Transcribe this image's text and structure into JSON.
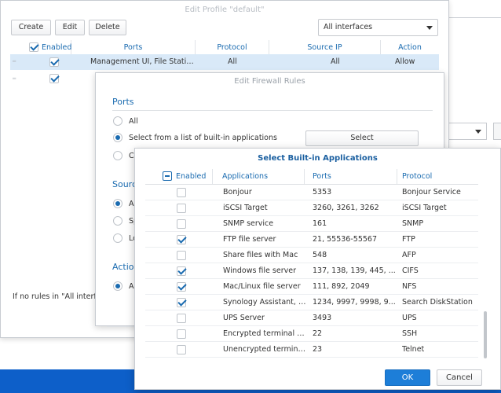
{
  "edit_profile": {
    "title": "Edit Profile \"default\"",
    "create_label": "Create",
    "edit_label": "Edit",
    "delete_label": "Delete",
    "interface_select": "All interfaces",
    "headers": [
      "Enabled",
      "Ports",
      "Protocol",
      "Source IP",
      "Action"
    ],
    "rows": [
      {
        "enabled": true,
        "ports": "Management UI, File Statio...",
        "protocol": "All",
        "source_ip": "All",
        "action": "Allow"
      },
      {
        "enabled": true,
        "ports": "",
        "protocol": "",
        "source_ip": "",
        "action": ""
      }
    ],
    "footer_note": "If no rules in \"All interfac"
  },
  "edit_firewall": {
    "title": "Edit Firewall Rules",
    "ports_section": "Ports",
    "port_options": [
      "All",
      "Select from a list of built-in applications",
      "C"
    ],
    "port_selected": 1,
    "select_button": "Select",
    "source_section": "Sourc",
    "source_options": [
      "Al",
      "Sp",
      "Lo"
    ],
    "source_selected": 0,
    "action_section": "Actio",
    "action_options": [
      "Al"
    ],
    "action_selected": 0
  },
  "builtin_apps": {
    "title": "Select Built-in Applications",
    "headers": [
      "Enabled",
      "Applications",
      "Ports",
      "Protocol"
    ],
    "header_check_state": "mixed",
    "rows": [
      {
        "enabled": false,
        "app": "Bonjour",
        "ports": "5353",
        "protocol": "Bonjour Service"
      },
      {
        "enabled": false,
        "app": "iSCSI Target",
        "ports": "3260, 3261, 3262",
        "protocol": "iSCSI Target"
      },
      {
        "enabled": false,
        "app": "SNMP service",
        "ports": "161",
        "protocol": "SNMP"
      },
      {
        "enabled": true,
        "app": "FTP file server",
        "ports": "21, 55536-55567",
        "protocol": "FTP"
      },
      {
        "enabled": false,
        "app": "Share files with Mac",
        "ports": "548",
        "protocol": "AFP"
      },
      {
        "enabled": true,
        "app": "Windows file server",
        "ports": "137, 138, 139, 445, ...",
        "protocol": "CIFS"
      },
      {
        "enabled": true,
        "app": "Mac/Linux file server",
        "ports": "111, 892, 2049",
        "protocol": "NFS"
      },
      {
        "enabled": true,
        "app": "Synology Assistant, N...",
        "ports": "1234, 9997, 9998, 9...",
        "protocol": "Search DiskStation"
      },
      {
        "enabled": false,
        "app": "UPS Server",
        "ports": "3493",
        "protocol": "UPS"
      },
      {
        "enabled": false,
        "app": "Encrypted terminal s...",
        "ports": "22",
        "protocol": "SSH"
      },
      {
        "enabled": false,
        "app": "Unencrypted terminal...",
        "ports": "23",
        "protocol": "Telnet"
      }
    ],
    "ok_label": "OK",
    "cancel_label": "Cancel"
  },
  "colors": {
    "accent": "#1a6bb0",
    "primary_button": "#1d7ed8",
    "selected_row": "#d9e9f8",
    "taskbar": "#0d5fc9"
  }
}
